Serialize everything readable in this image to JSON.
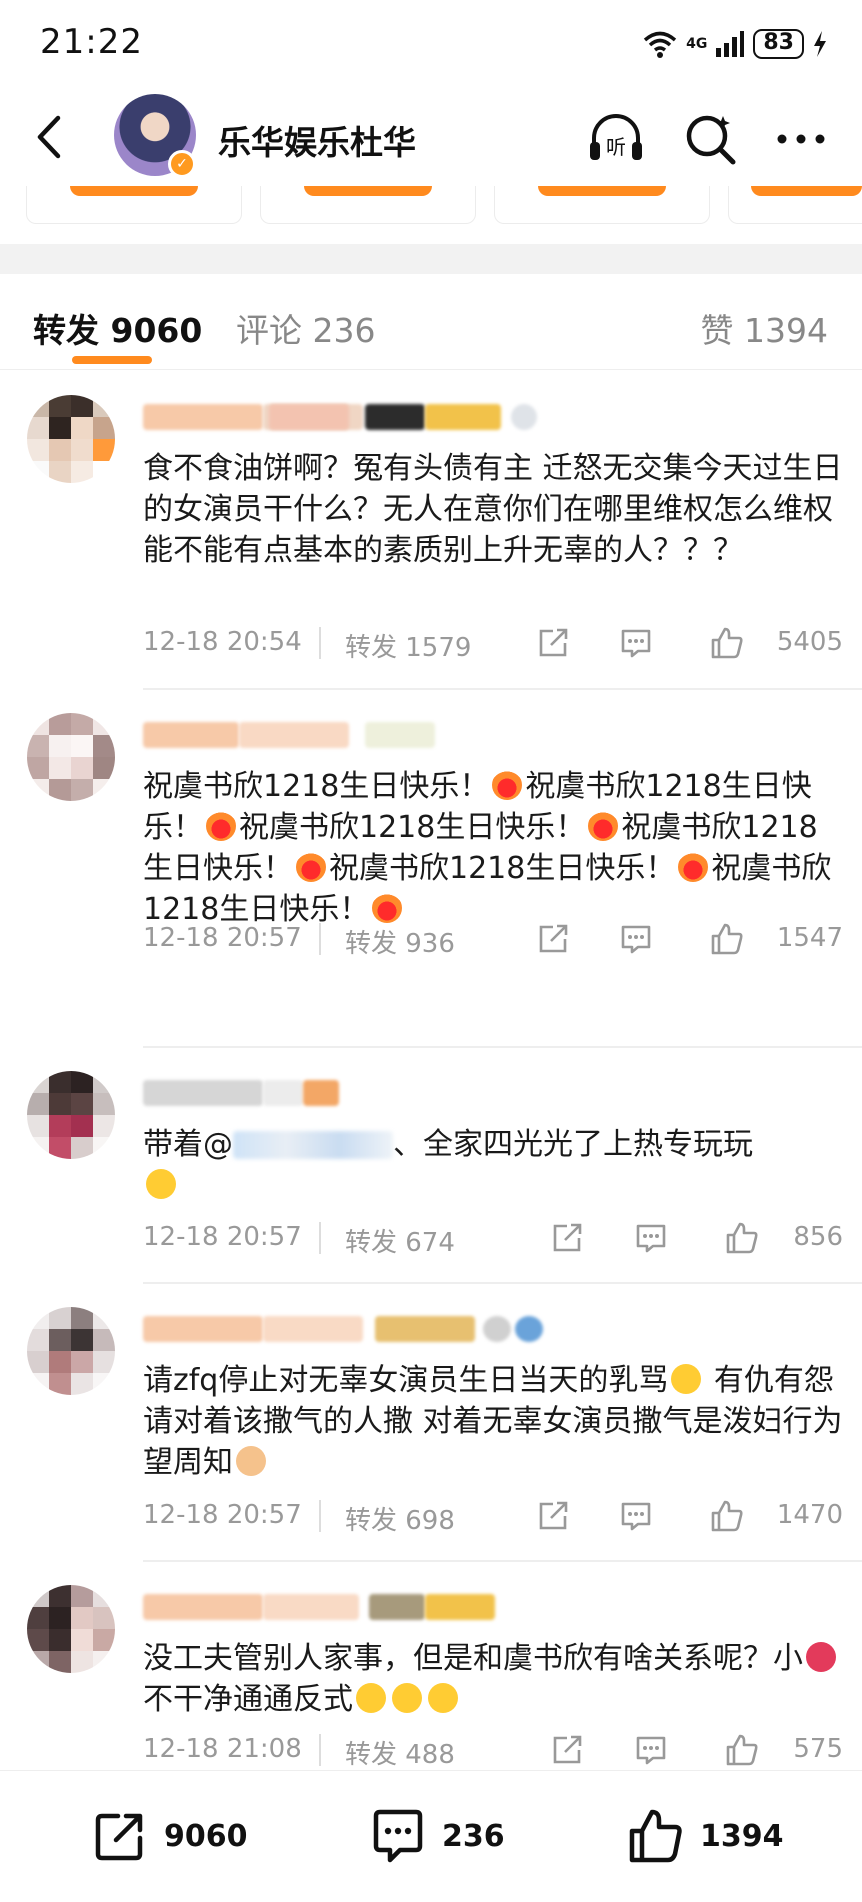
{
  "status_bar": {
    "time": "21:22",
    "network": "4G",
    "battery": "83"
  },
  "header": {
    "title": "乐华娱乐杜华",
    "icons": [
      "back-icon",
      "listen-icon",
      "search-icon",
      "more-icon"
    ],
    "listen_label": "听"
  },
  "tabs": {
    "reposts_label": "转发 9060",
    "comments_label": "评论 236",
    "likes_label": "赞 1394"
  },
  "accent_color": "#ff8a1e",
  "comments": [
    {
      "time": "12-18 20:54",
      "repost_label": "转发 1579",
      "likes": "5405",
      "text": "食不食油饼啊？冤有头债有主 迁怒无交集今天过生日的女演员干什么？无人在意你们在哪里维权怎么维权 能不能有点基本的素质别上升无辜的人？？？"
    },
    {
      "time": "12-18 20:57",
      "repost_label": "转发 936",
      "likes": "1547",
      "segments": [
        "祝虞书欣1218生日快乐！",
        "祝虞书欣1218生日快乐！",
        "祝虞书欣1218生日快乐！",
        "祝虞书欣1218生日快乐！",
        "祝虞书欣1218生日快乐！",
        "祝虞书欣1218生日快乐！"
      ]
    },
    {
      "time": "12-18 20:57",
      "repost_label": "转发 674",
      "likes": "856",
      "text_before": "带着@",
      "text_after": "、全家四光光了上热专玩玩"
    },
    {
      "time": "12-18 20:57",
      "repost_label": "转发 698",
      "likes": "1470",
      "text_a": "请zfq停止对无辜女演员生日当天的乳骂",
      "text_b": " 有仇有怨请对着该撒气的人撒 对着无辜女演员撒气是泼妇行为 望周知"
    },
    {
      "time": "12-18 21:08",
      "repost_label": "转发 488",
      "likes": "575",
      "text_a": "没工夫管别人家事，但是和虞书欣有啥关系呢？小",
      "text_b": "不干净通通反式"
    }
  ],
  "bottom_bar": {
    "reposts": "9060",
    "comments": "236",
    "likes": "1394"
  }
}
